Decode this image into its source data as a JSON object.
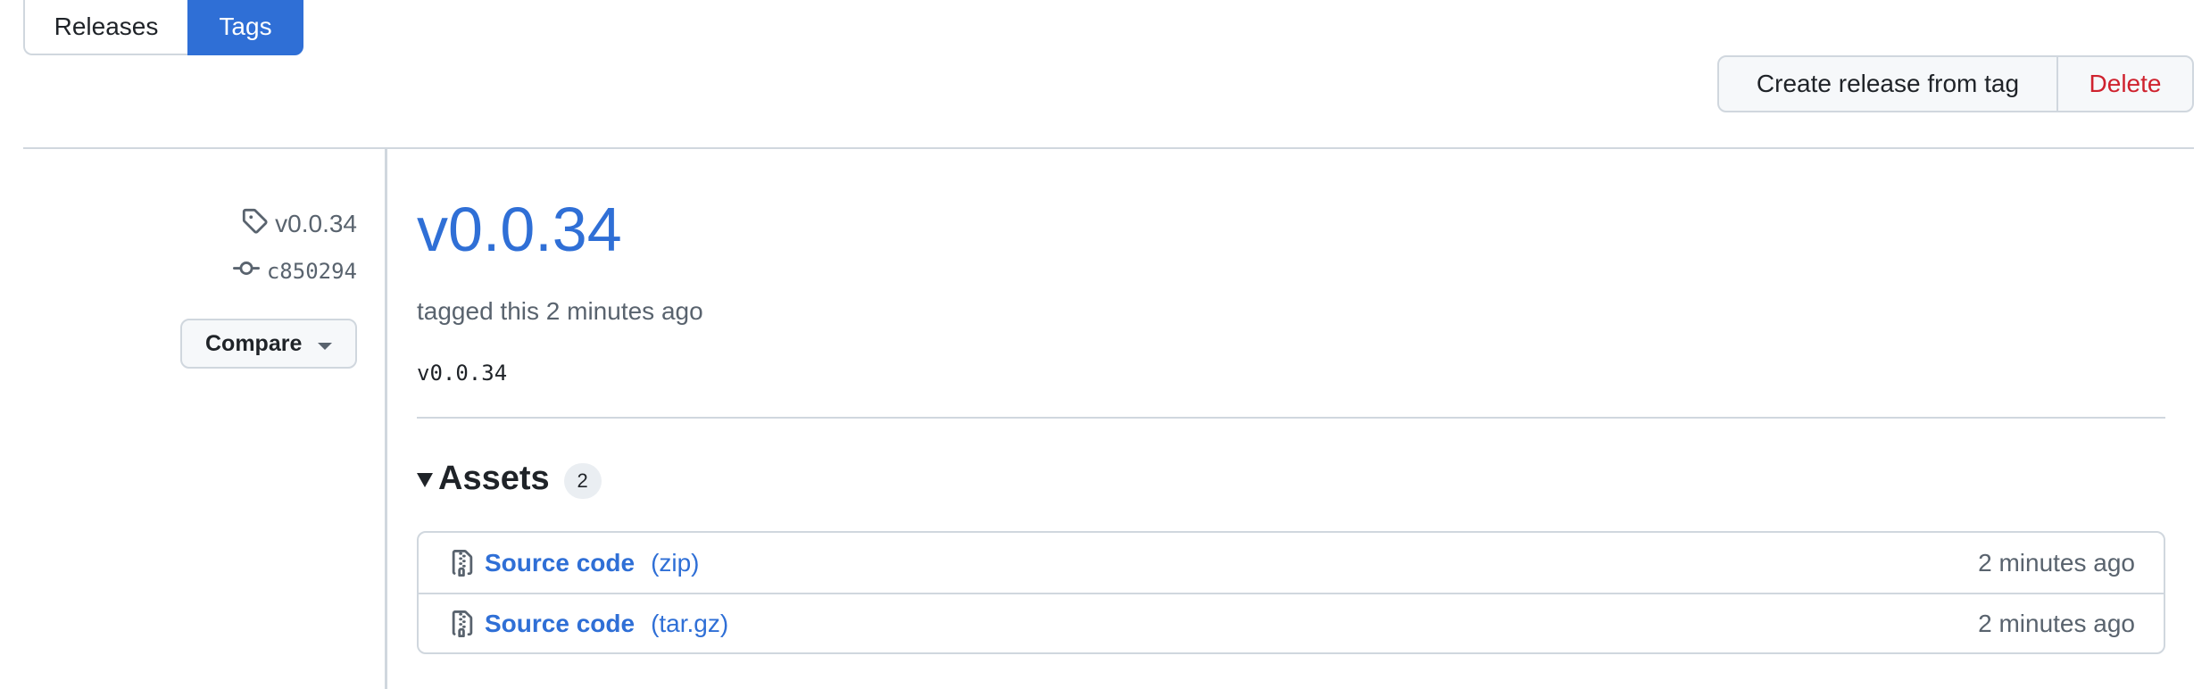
{
  "tabs": [
    {
      "label": "Releases",
      "active": false
    },
    {
      "label": "Tags",
      "active": true
    }
  ],
  "actions": {
    "create_label": "Create release from tag",
    "delete_label": "Delete"
  },
  "sidebar": {
    "tag": "v0.0.34",
    "commit": "c850294",
    "compare_label": "Compare"
  },
  "release": {
    "title": "v0.0.34",
    "tagged_text": "tagged this 2 minutes ago",
    "body": "v0.0.34"
  },
  "assets": {
    "title": "Assets",
    "count": "2",
    "items": [
      {
        "name": "Source code",
        "ext": "(zip)",
        "time": "2 minutes ago"
      },
      {
        "name": "Source code",
        "ext": "(tar.gz)",
        "time": "2 minutes ago"
      }
    ]
  },
  "colors": {
    "accent": "#2f6fd6",
    "danger": "#cf222e",
    "border": "#d0d7de",
    "muted": "#59636e"
  },
  "icons": {
    "tag": "tag-icon",
    "commit": "commit-icon",
    "archive": "file-zip-icon",
    "caret": "caret-down-icon",
    "disclosure": "triangle-down-icon"
  }
}
